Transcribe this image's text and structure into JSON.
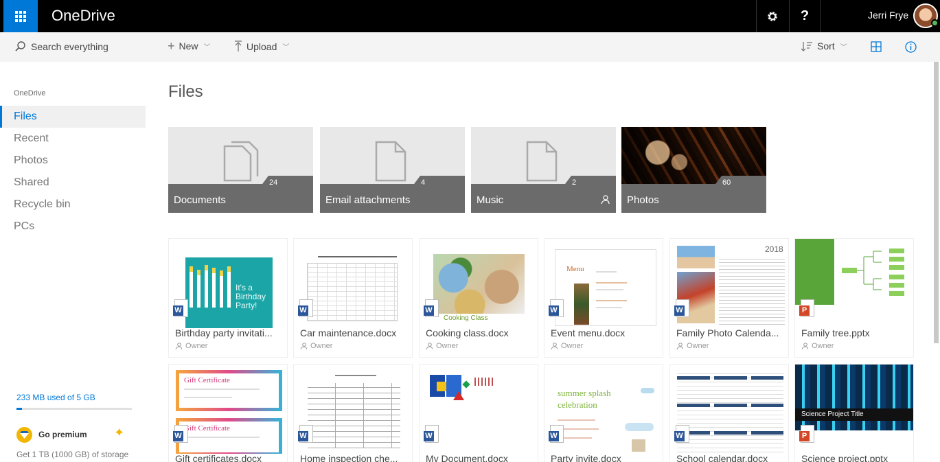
{
  "app": {
    "title": "OneDrive"
  },
  "header": {
    "user_name": "Jerri Frye",
    "help_label": "?"
  },
  "search": {
    "placeholder": "Search everything"
  },
  "sidebar": {
    "heading": "OneDrive",
    "items": [
      {
        "label": "Files",
        "selected": true
      },
      {
        "label": "Recent"
      },
      {
        "label": "Photos"
      },
      {
        "label": "Shared"
      },
      {
        "label": "Recycle bin"
      },
      {
        "label": "PCs"
      }
    ],
    "storage": {
      "used_text": "233 MB used of 5 GB",
      "fraction": 0.05
    },
    "premium": {
      "label": "Go premium",
      "offer": "Get 1 TB (1000 GB) of storage"
    }
  },
  "toolbar": {
    "new_label": "New",
    "upload_label": "Upload",
    "sort_label": "Sort"
  },
  "main": {
    "title": "Files",
    "folders": [
      {
        "name": "Documents",
        "count": "24"
      },
      {
        "name": "Email attachments",
        "count": "4"
      },
      {
        "name": "Music",
        "count": "2",
        "shared": true
      },
      {
        "name": "Photos",
        "count": "60"
      }
    ],
    "files": [
      {
        "name": "Birthday party invitati...",
        "owner": "Owner",
        "type": "W",
        "thumb_text": "It's a Birthday Party!"
      },
      {
        "name": "Car maintenance.docx",
        "owner": "Owner",
        "type": "W"
      },
      {
        "name": "Cooking class.docx",
        "owner": "Owner",
        "type": "W",
        "thumb_text": "Cooking Class"
      },
      {
        "name": "Event menu.docx",
        "owner": "Owner",
        "type": "W",
        "thumb_text": "Menu"
      },
      {
        "name": "Family Photo Calenda...",
        "owner": "Owner",
        "type": "W",
        "thumb_text": "2018"
      },
      {
        "name": "Family tree.pptx",
        "owner": "Owner",
        "type": "P"
      },
      {
        "name": "Gift certificates.docx",
        "type": "W",
        "thumb_text": "Gift Certificate"
      },
      {
        "name": "Home inspection che...",
        "type": "W"
      },
      {
        "name": "My Document.docx",
        "type": "W"
      },
      {
        "name": "Party invite.docx",
        "type": "W",
        "thumb_text": "summer splash celebration"
      },
      {
        "name": "School calendar.docx",
        "type": "W"
      },
      {
        "name": "Science project.pptx",
        "type": "P",
        "thumb_text": "Science Project Title"
      }
    ]
  },
  "colors": {
    "accent": "#0078d7",
    "topbar": "#000000",
    "word": "#2b579a",
    "powerpoint": "#d24726",
    "premium": "#f2b600"
  }
}
